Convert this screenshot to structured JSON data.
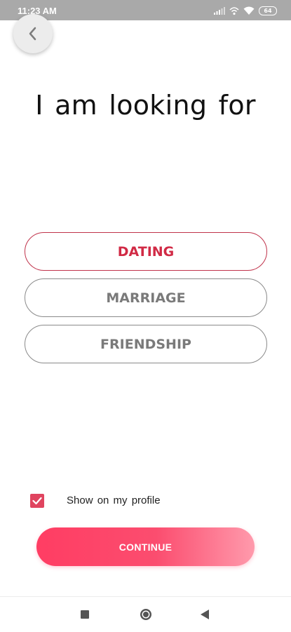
{
  "status_bar": {
    "time": "11:23 AM",
    "battery": "64",
    "icons": [
      "signal-icon",
      "data-icon",
      "wifi-icon",
      "battery-icon"
    ]
  },
  "header": {
    "back_icon": "chevron-left-icon",
    "title": "I am looking for"
  },
  "options": [
    {
      "label": "DATING",
      "selected": true
    },
    {
      "label": "MARRIAGE",
      "selected": false
    },
    {
      "label": "FRIENDSHIP",
      "selected": false
    }
  ],
  "profile_toggle": {
    "label": "Show on my profile",
    "checked": true
  },
  "continue_label": "CONTINUE",
  "nav_bar": {
    "icons": [
      "recents-square-icon",
      "home-circle-icon",
      "back-triangle-icon"
    ]
  },
  "colors": {
    "accent": "#d12a45",
    "button_gradient_start": "#ff3d63",
    "button_gradient_end": "#ff9aac",
    "checkbox": "#e0445f",
    "status_bar": "#a9a9a9"
  }
}
